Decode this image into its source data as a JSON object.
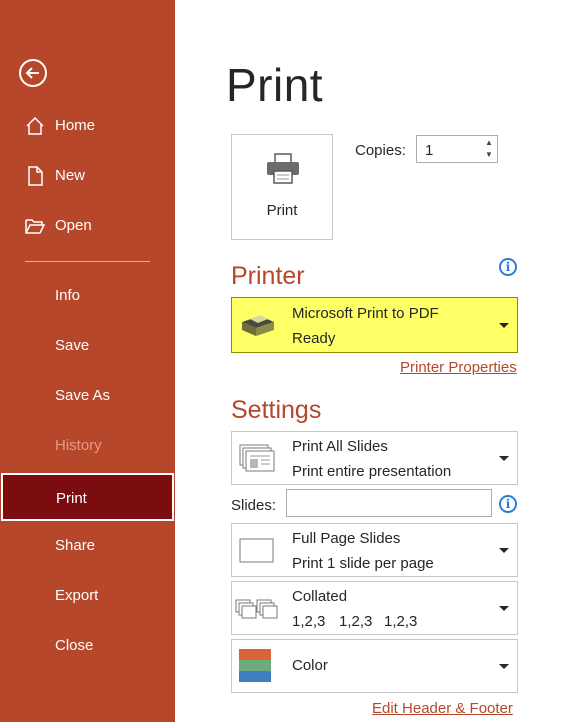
{
  "sidebar": {
    "items": [
      {
        "label": "Home"
      },
      {
        "label": "New"
      },
      {
        "label": "Open"
      },
      {
        "label": "Info"
      },
      {
        "label": "Save"
      },
      {
        "label": "Save As"
      },
      {
        "label": "History"
      },
      {
        "label": "Print"
      },
      {
        "label": "Share"
      },
      {
        "label": "Export"
      },
      {
        "label": "Close"
      }
    ],
    "selected": "Print",
    "accent_color": "#b7472a",
    "selected_color": "#7b0d10"
  },
  "main": {
    "title": "Print",
    "print_button_label": "Print",
    "copies": {
      "label": "Copies:",
      "value": "1"
    },
    "printer": {
      "heading": "Printer",
      "name": "Microsoft Print to PDF",
      "status": "Ready",
      "properties_link": "Printer Properties"
    },
    "settings": {
      "heading": "Settings",
      "slides_option": {
        "title": "Print All Slides",
        "subtitle": "Print entire presentation"
      },
      "slides_label": "Slides:",
      "slides_value": "",
      "layout_option": {
        "title": "Full Page Slides",
        "subtitle": "Print 1 slide per page"
      },
      "collate_option": {
        "title": "Collated",
        "numbers": [
          "1,2,3",
          "1,2,3",
          "1,2,3"
        ]
      },
      "color_option": {
        "title": "Color"
      },
      "edit_link": "Edit Header & Footer"
    }
  }
}
